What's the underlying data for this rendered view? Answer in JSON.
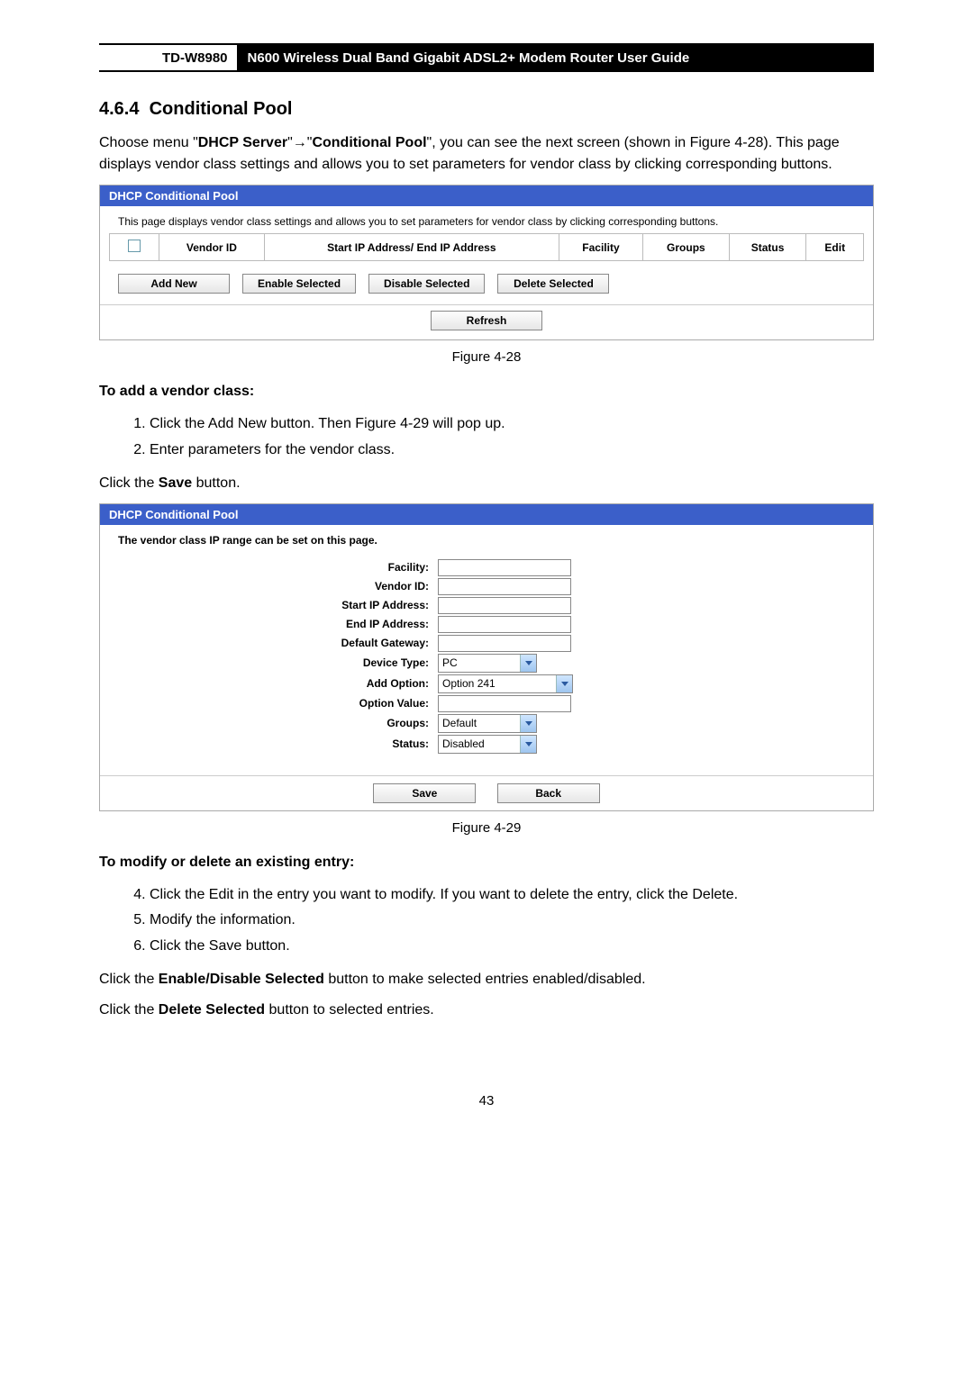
{
  "header": {
    "model": "TD-W8980",
    "title": "N600 Wireless Dual Band Gigabit ADSL2+ Modem Router User Guide"
  },
  "section": {
    "number": "4.6.4",
    "title": "Conditional Pool"
  },
  "intro": {
    "pre": "Choose menu \"",
    "menu1": "DHCP Server",
    "arrow": "→",
    "menu2": "Conditional Pool",
    "post": "\", you can see the next screen (shown in Figure 4-28). This page displays vendor class settings and allows you to set parameters for vendor class by clicking corresponding buttons."
  },
  "fig28": {
    "title": "DHCP Conditional Pool",
    "desc": "This page displays vendor class settings and allows you to set parameters for vendor class by clicking corresponding buttons.",
    "headers": [
      "Vendor ID",
      "Start IP Address/ End IP Address",
      "Facility",
      "Groups",
      "Status",
      "Edit"
    ],
    "buttons": {
      "add_new": "Add New",
      "enable_selected": "Enable Selected",
      "disable_selected": "Disable Selected",
      "delete_selected": "Delete Selected",
      "refresh": "Refresh"
    },
    "caption": "Figure 4-28"
  },
  "add_vendor": {
    "heading": "To add a vendor class:",
    "steps": [
      {
        "pre": "Click the ",
        "bold": "Add New",
        "post": " button. Then Figure 4-29 will pop up."
      },
      {
        "pre": "Enter parameters for the vendor class.",
        "bold": "",
        "post": ""
      }
    ],
    "click_save_pre": "Click the ",
    "click_save_bold": "Save",
    "click_save_post": " button."
  },
  "fig29": {
    "title": "DHCP Conditional Pool",
    "desc": "The vendor class IP range can be set on this page.",
    "fields": {
      "facility": "Facility:",
      "vendor_id": "Vendor ID:",
      "start_ip": "Start IP Address:",
      "end_ip": "End IP Address:",
      "default_gateway": "Default Gateway:",
      "device_type": "Device Type:",
      "add_option": "Add Option:",
      "option_value": "Option Value:",
      "groups": "Groups:",
      "status": "Status:"
    },
    "values": {
      "device_type": "PC",
      "add_option": "Option 241",
      "groups": "Default",
      "status": "Disabled"
    },
    "buttons": {
      "save": "Save",
      "back": "Back"
    },
    "caption": "Figure 4-29"
  },
  "modify": {
    "heading": "To modify or delete an existing entry:",
    "steps": [
      {
        "pre": "Click the ",
        "bold1": "Edit",
        "mid": " in the entry you want to modify. If you want to delete the entry, click the ",
        "bold2": "Delete",
        "post": "."
      },
      {
        "text": "Modify the information."
      },
      {
        "pre": "Click the ",
        "bold1": "Save",
        "post": " button."
      }
    ],
    "line1_pre": "Click the ",
    "line1_bold": "Enable/Disable Selected",
    "line1_post": " button to make selected entries enabled/disabled.",
    "line2_pre": "Click the ",
    "line2_bold": "Delete Selected",
    "line2_post": " button to selected entries."
  },
  "page_number": "43"
}
